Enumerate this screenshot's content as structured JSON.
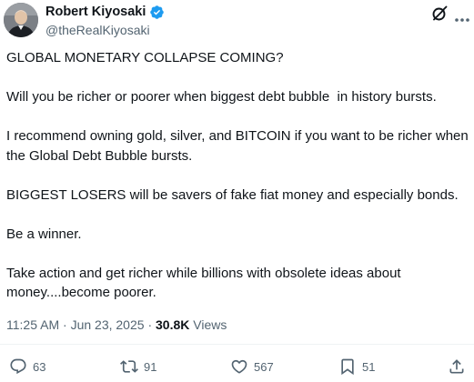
{
  "author": {
    "display_name": "Robert Kiyosaki",
    "handle": "@theRealKiyosaki",
    "verified": true
  },
  "header_icons": [
    "grok-icon",
    "more-icon"
  ],
  "post": {
    "paragraphs": [
      "GLOBAL MONETARY COLLAPSE COMING?",
      "Will you be richer or poorer when biggest debt bubble  in history bursts.",
      "I recommend owning gold, silver, and BITCOIN if you want to be richer when the Global Debt Bubble bursts.",
      "BIGGEST LOSERS will be savers of fake fiat money and especially bonds.",
      "Be a winner.",
      "Take action and get richer while billions with obsolete ideas about money....become poorer."
    ]
  },
  "meta": {
    "time": "11:25 AM",
    "separator": "·",
    "date": "Jun 23, 2025",
    "views_count": "30.8K",
    "views_label": "Views"
  },
  "actions": {
    "replies": "63",
    "reposts": "91",
    "likes": "567",
    "bookmarks": "51"
  },
  "colors": {
    "text": "#0f1419",
    "secondary": "#536471",
    "verified": "#1d9bf0",
    "divider": "#eff3f4"
  }
}
